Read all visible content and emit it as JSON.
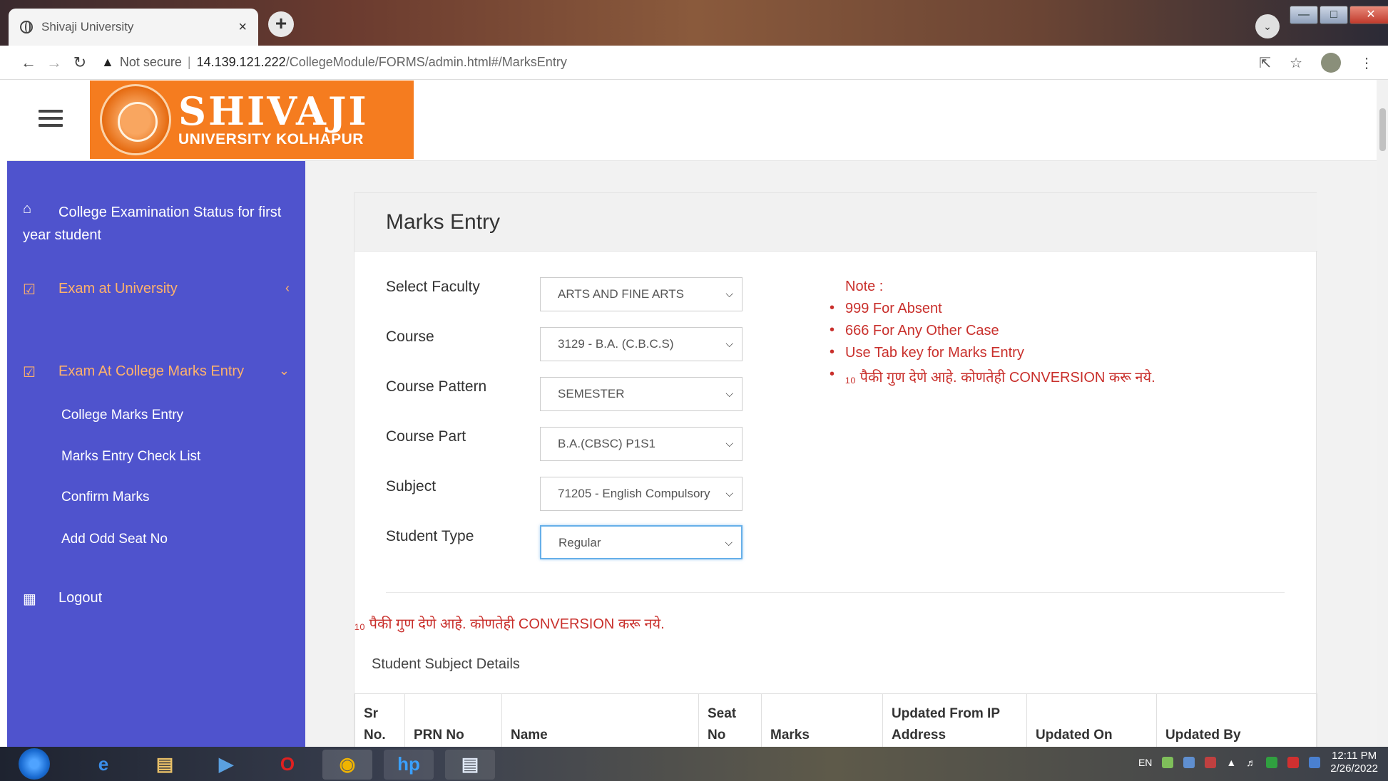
{
  "browser": {
    "tab_title": "Shivaji University",
    "tab_close": "×",
    "new_tab": "+",
    "url_not_secure": "Not secure",
    "url_host": "14.139.121.222",
    "url_path": "/CollegeModule/FORMS/admin.html#/MarksEntry"
  },
  "header": {
    "logo_title": "SHIVAJI",
    "logo_subtitle": "UNIVERSITY KOLHAPUR"
  },
  "sidebar": {
    "items": [
      {
        "label": "College Examination Status for first year student",
        "icon": "home-icon"
      },
      {
        "label": "Exam at University",
        "icon": "checkbox-icon"
      },
      {
        "label": "Exam At College Marks Entry",
        "icon": "checkbox-icon"
      },
      {
        "label": "College Marks Entry"
      },
      {
        "label": "Marks Entry Check List"
      },
      {
        "label": "Confirm Marks"
      },
      {
        "label": "Add Odd Seat No"
      },
      {
        "label": "Logout",
        "icon": "table-icon"
      }
    ]
  },
  "main": {
    "title": "Marks Entry",
    "fields": [
      {
        "label": "Select Faculty",
        "value": "ARTS AND FINE ARTS"
      },
      {
        "label": "Course",
        "value": "3129 - B.A. (C.B.C.S)"
      },
      {
        "label": "Course Pattern",
        "value": "SEMESTER"
      },
      {
        "label": "Course Part",
        "value": "B.A.(CBSC) P1S1"
      },
      {
        "label": "Subject",
        "value": "71205 - English Compulsory"
      },
      {
        "label": "Student Type",
        "value": "Regular"
      }
    ],
    "note": {
      "heading": "Note :",
      "items": [
        "999 For Absent",
        "666 For Any Other Case",
        "Use Tab key for Marks Entry",
        "₁₀ पैकी गुण देणे आहे. कोणतेही CONVERSION करू नये."
      ]
    },
    "red_notice": "₁₀ पैकी गुण देणे आहे. कोणतेही CONVERSION करू नये.",
    "details_heading": "Student Subject Details",
    "table_headers": [
      "Sr No.",
      "PRN No",
      "Name",
      "Seat No",
      "Marks",
      "Updated From IP Address",
      "Updated On",
      "Updated By"
    ]
  },
  "taskbar": {
    "lang": "EN",
    "time": "12:11 PM",
    "date": "2/26/2022"
  },
  "colors": {
    "sidebar_bg": "#4f53cd",
    "logo_bg": "#f57c1f",
    "note_red": "#c9302c",
    "sidebar_accent": "#ffb26b"
  }
}
